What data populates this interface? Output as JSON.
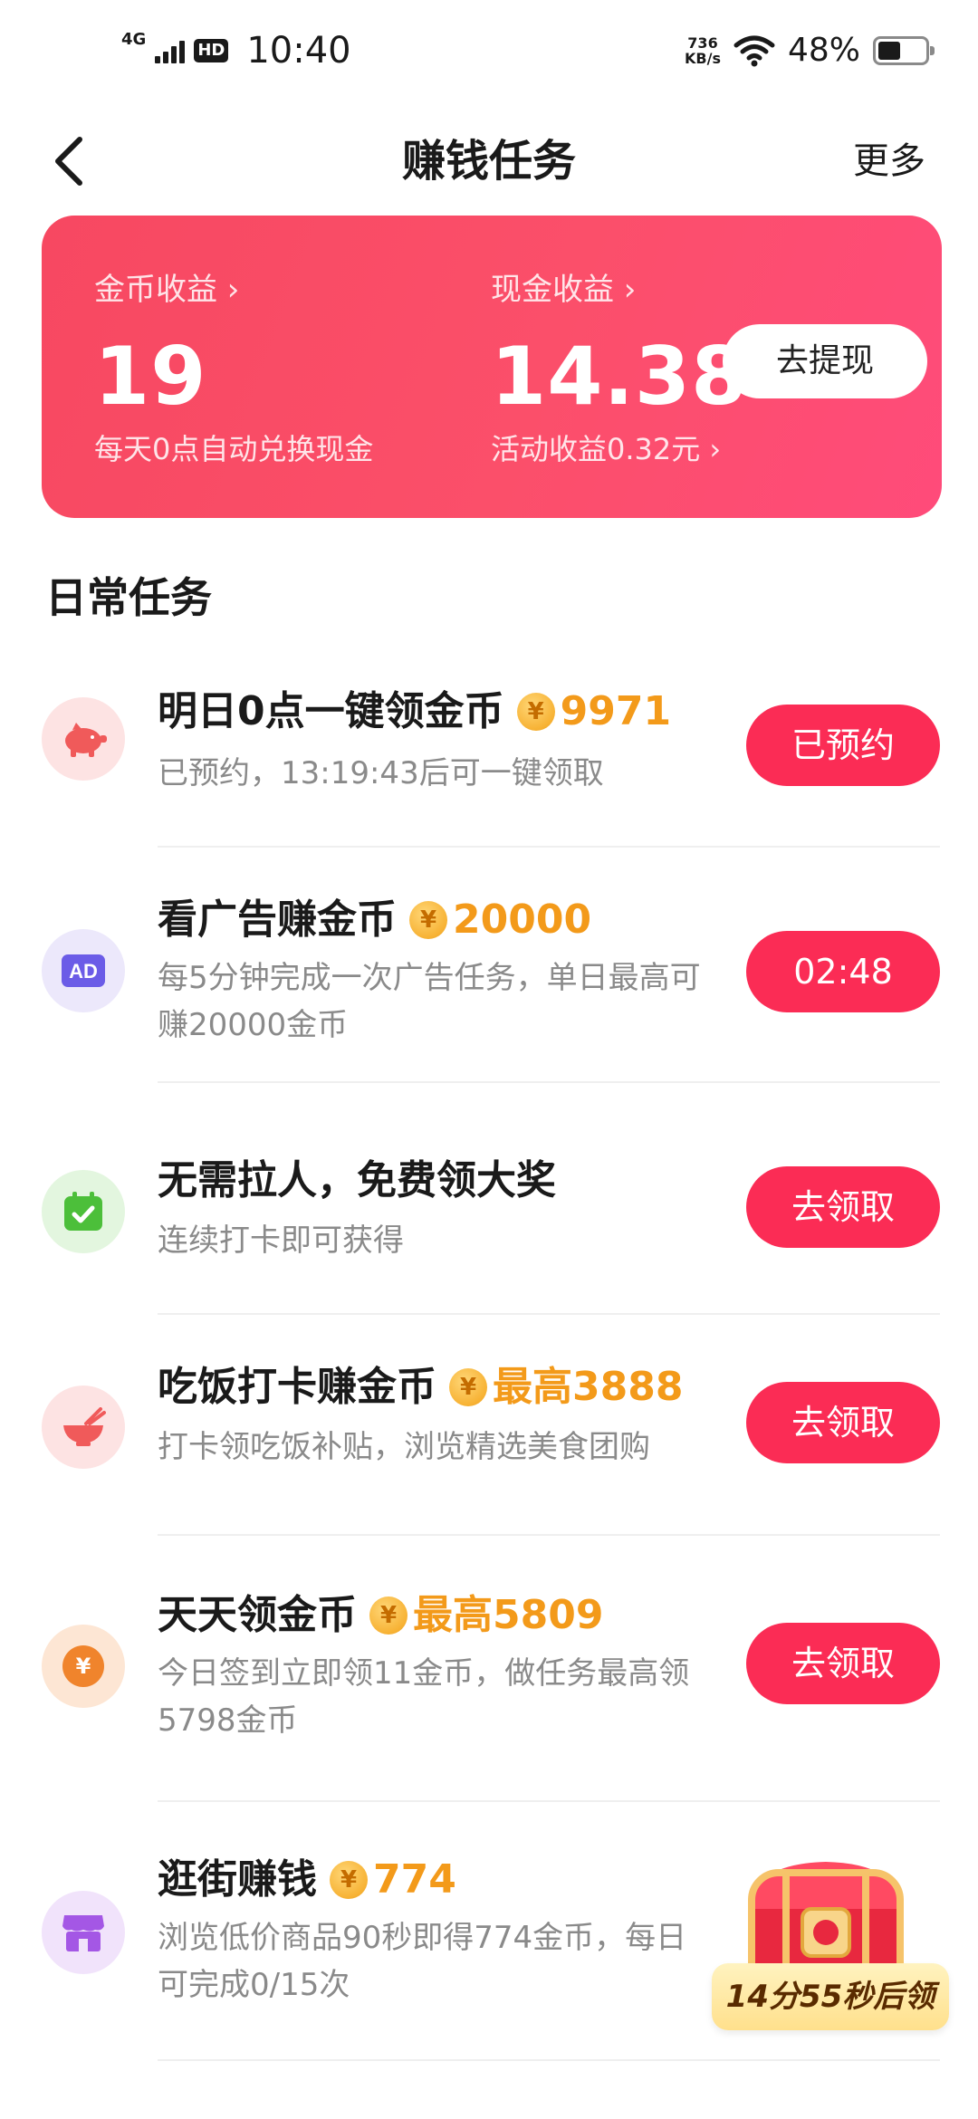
{
  "status_bar": {
    "network": "4G",
    "hd": "HD",
    "time": "10:40",
    "speed_value": "736",
    "speed_unit": "KB/s",
    "battery": "48%",
    "battery_level": 0.48
  },
  "nav": {
    "title": "赚钱任务",
    "more": "更多"
  },
  "earnings": {
    "coin_label": "金币收益 ›",
    "coin_value": "19",
    "coin_sub": "每天0点自动兑换现金",
    "cash_label": "现金收益 ›",
    "cash_value": "14.38",
    "cash_sub": "活动收益0.32元 ›",
    "withdraw": "去提现"
  },
  "section_title": "日常任务",
  "tasks": [
    {
      "icon": "piggy-bank-icon",
      "title": "明日0点一键领金币",
      "reward": "9971",
      "desc": "已预约，13:19:43后可一键领取",
      "button": "已预约"
    },
    {
      "icon": "ad-icon",
      "title": "看广告赚金币",
      "reward": "20000",
      "desc": "每5分钟完成一次广告任务，单日最高可赚20000金币",
      "button": "02:48"
    },
    {
      "icon": "calendar-check-icon",
      "title": "无需拉人，免费领大奖",
      "reward": "",
      "desc": "连续打卡即可获得",
      "button": "去领取"
    },
    {
      "icon": "bowl-icon",
      "title": "吃饭打卡赚金币",
      "reward": "最高3888",
      "desc": "打卡领吃饭补贴，浏览精选美食团购",
      "button": "去领取"
    },
    {
      "icon": "yuan-coin-icon",
      "title": "天天领金币",
      "reward": "最高5809",
      "desc": "今日签到立即领11金币，做任务最高领5798金币",
      "button": "去领取"
    },
    {
      "icon": "shop-icon",
      "title": "逛街赚钱",
      "reward": "774",
      "desc": "浏览低价商品90秒即得774金币，每日可完成0/15次",
      "button": ""
    }
  ],
  "chest": {
    "timer": "14分55秒后领"
  },
  "coin_symbol": "¥"
}
